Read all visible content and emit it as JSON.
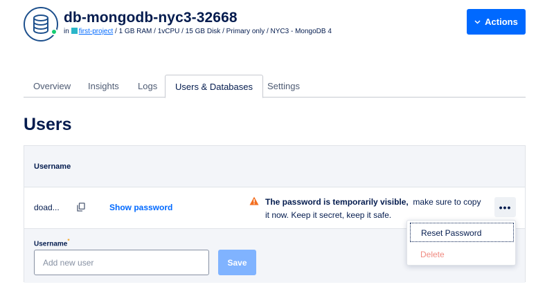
{
  "database": {
    "name": "db-mongodb-nyc3-32668",
    "meta_prefix": "in",
    "project_link": "first-project",
    "meta_details": "/ 1 GB RAM / 1vCPU / 15 GB Disk / Primary only / NYC3 - MongoDB 4",
    "status_color": "#15cd72"
  },
  "header": {
    "actions_label": "Actions"
  },
  "tabs": [
    {
      "label": "Overview",
      "active": false
    },
    {
      "label": "Insights",
      "active": false
    },
    {
      "label": "Logs",
      "active": false
    },
    {
      "label": "Users & Databases",
      "active": true
    },
    {
      "label": "Settings",
      "active": false
    }
  ],
  "users": {
    "title": "Users",
    "column_username": "Username",
    "rows": [
      {
        "username": "doad...",
        "show_password_label": "Show password",
        "warning_bold": "The password is temporarily visible,",
        "warning_text": "make sure to copy it now. Keep it secret, keep it safe.",
        "more_label": "•••"
      }
    ],
    "add_form": {
      "label": "Username",
      "required_mark": "*",
      "placeholder": "Add new user",
      "save_label": "Save"
    }
  },
  "row_menu": {
    "items": [
      {
        "label": "Reset Password",
        "disabled": false
      },
      {
        "label": "Delete",
        "disabled": true
      }
    ]
  },
  "colors": {
    "primary": "#0069ff",
    "primary_disabled": "#80b3ff",
    "warning": "#f36f21",
    "danger_disabled": "#f08a80",
    "text": "#031b4e"
  },
  "icons": [
    "database-icon",
    "project-icon",
    "chevron-down-icon",
    "copy-icon",
    "warning-icon",
    "more-icon"
  ]
}
